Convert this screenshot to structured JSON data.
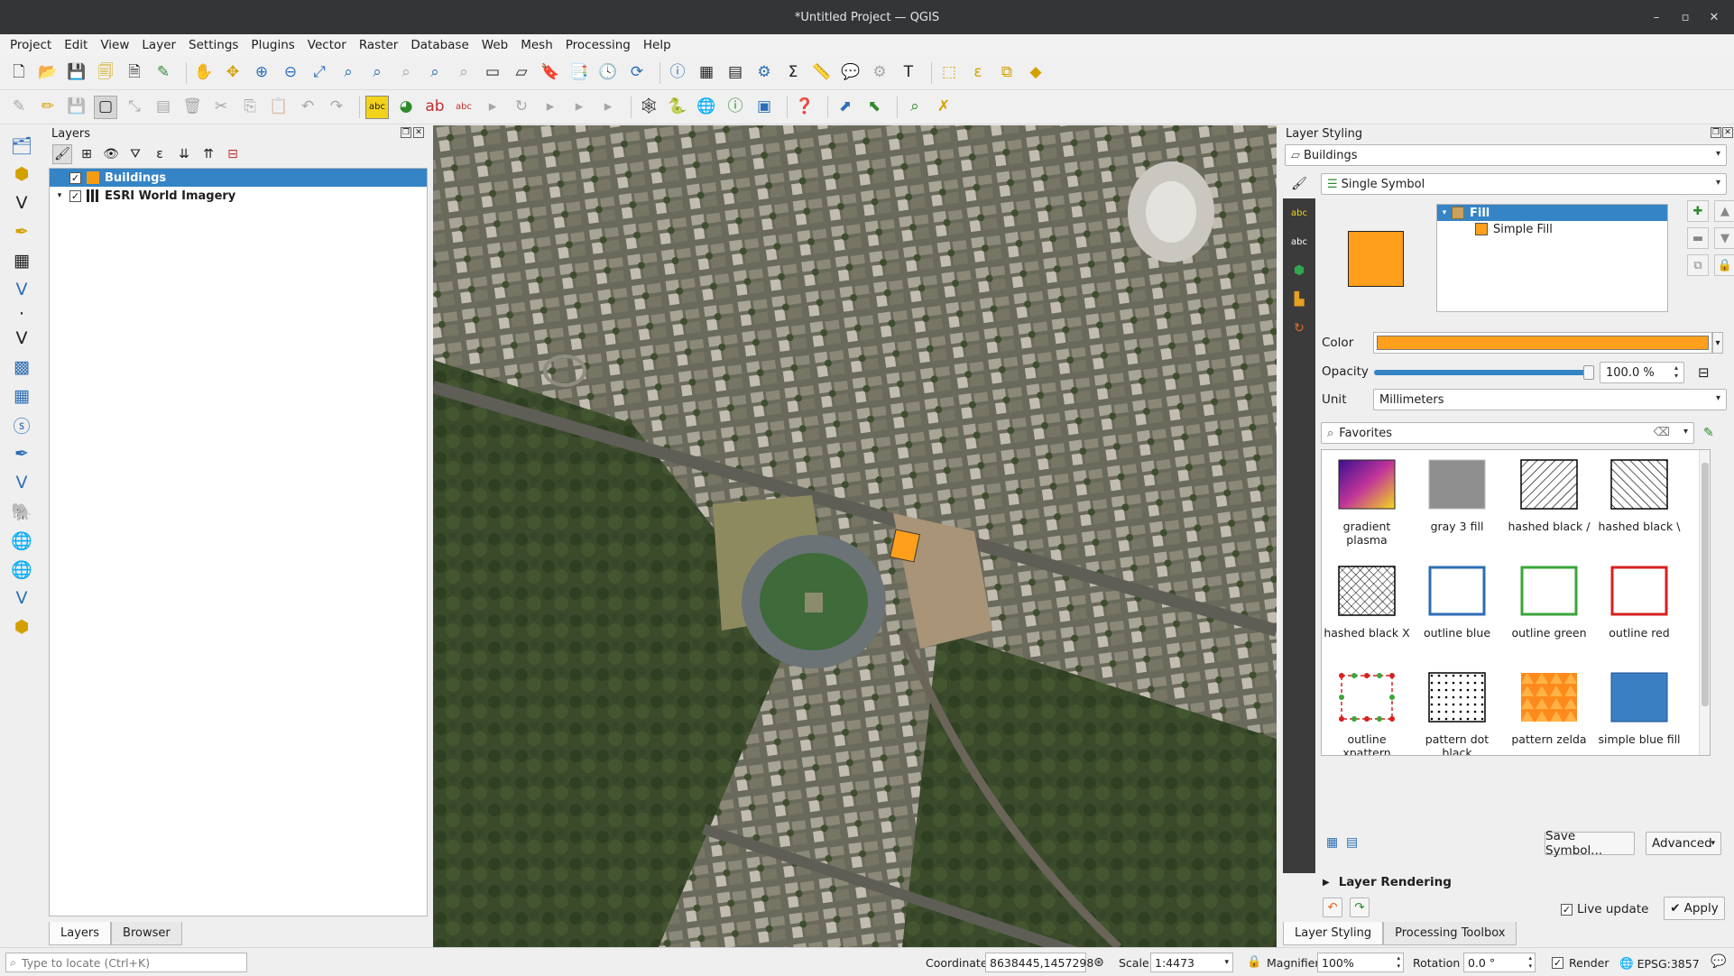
{
  "window": {
    "title": "*Untitled Project — QGIS"
  },
  "menu": [
    "Project",
    "Edit",
    "View",
    "Layer",
    "Settings",
    "Plugins",
    "Vector",
    "Raster",
    "Database",
    "Web",
    "Mesh",
    "Processing",
    "Help"
  ],
  "layers_panel": {
    "title": "Layers",
    "layers": [
      {
        "name": "Buildings",
        "checked": true,
        "selected": true,
        "color": "#f39c12"
      },
      {
        "name": "ESRI World Imagery",
        "checked": true,
        "selected": false
      }
    ],
    "tabs": [
      "Layers",
      "Browser"
    ]
  },
  "styling_panel": {
    "title": "Layer Styling",
    "layer": "Buildings",
    "renderer": "Single Symbol",
    "symbol_tree": {
      "root": "Fill",
      "child": "Simple Fill"
    },
    "preview_color": "#ff9f1c",
    "color_label": "Color",
    "opacity_label": "Opacity",
    "opacity_value": "100.0 %",
    "opacity_fraction": 1.0,
    "unit_label": "Unit",
    "unit_value": "Millimeters",
    "search_value": "Favorites",
    "favorites": [
      {
        "name": "gradient plasma",
        "icon": "gradient-plasma"
      },
      {
        "name": "gray 3 fill",
        "icon": "gray-fill"
      },
      {
        "name": "hashed black /",
        "icon": "hatch-forward"
      },
      {
        "name": "hashed black \\",
        "icon": "hatch-back"
      },
      {
        "name": "hashed black X",
        "icon": "hatch-cross"
      },
      {
        "name": "outline blue",
        "icon": "outline-blue"
      },
      {
        "name": "outline green",
        "icon": "outline-green"
      },
      {
        "name": "outline red",
        "icon": "outline-red"
      },
      {
        "name": "outline xpattern",
        "icon": "outline-xpattern"
      },
      {
        "name": "pattern dot black",
        "icon": "dot-pattern"
      },
      {
        "name": "pattern zelda",
        "icon": "zelda-pattern"
      },
      {
        "name": "simple blue fill",
        "icon": "blue-fill"
      },
      {
        "name": "",
        "icon": "green-fill"
      },
      {
        "name": "",
        "icon": "red-fill"
      }
    ],
    "save_symbol": "Save Symbol...",
    "advanced": "Advanced",
    "layer_rendering": "Layer Rendering",
    "live_update": "Live update",
    "apply": "Apply",
    "tabs": [
      "Layer Styling",
      "Processing Toolbox"
    ]
  },
  "statusbar": {
    "locator_placeholder": "Type to locate (Ctrl+K)",
    "coordinate_label": "Coordinate",
    "coordinate": "8638445,1457298",
    "scale_label": "Scale",
    "scale": "1:4473",
    "magnifier_label": "Magnifier",
    "magnifier": "100%",
    "rotation_label": "Rotation",
    "rotation": "0.0 °",
    "render_label": "Render",
    "crs": "EPSG:3857"
  }
}
